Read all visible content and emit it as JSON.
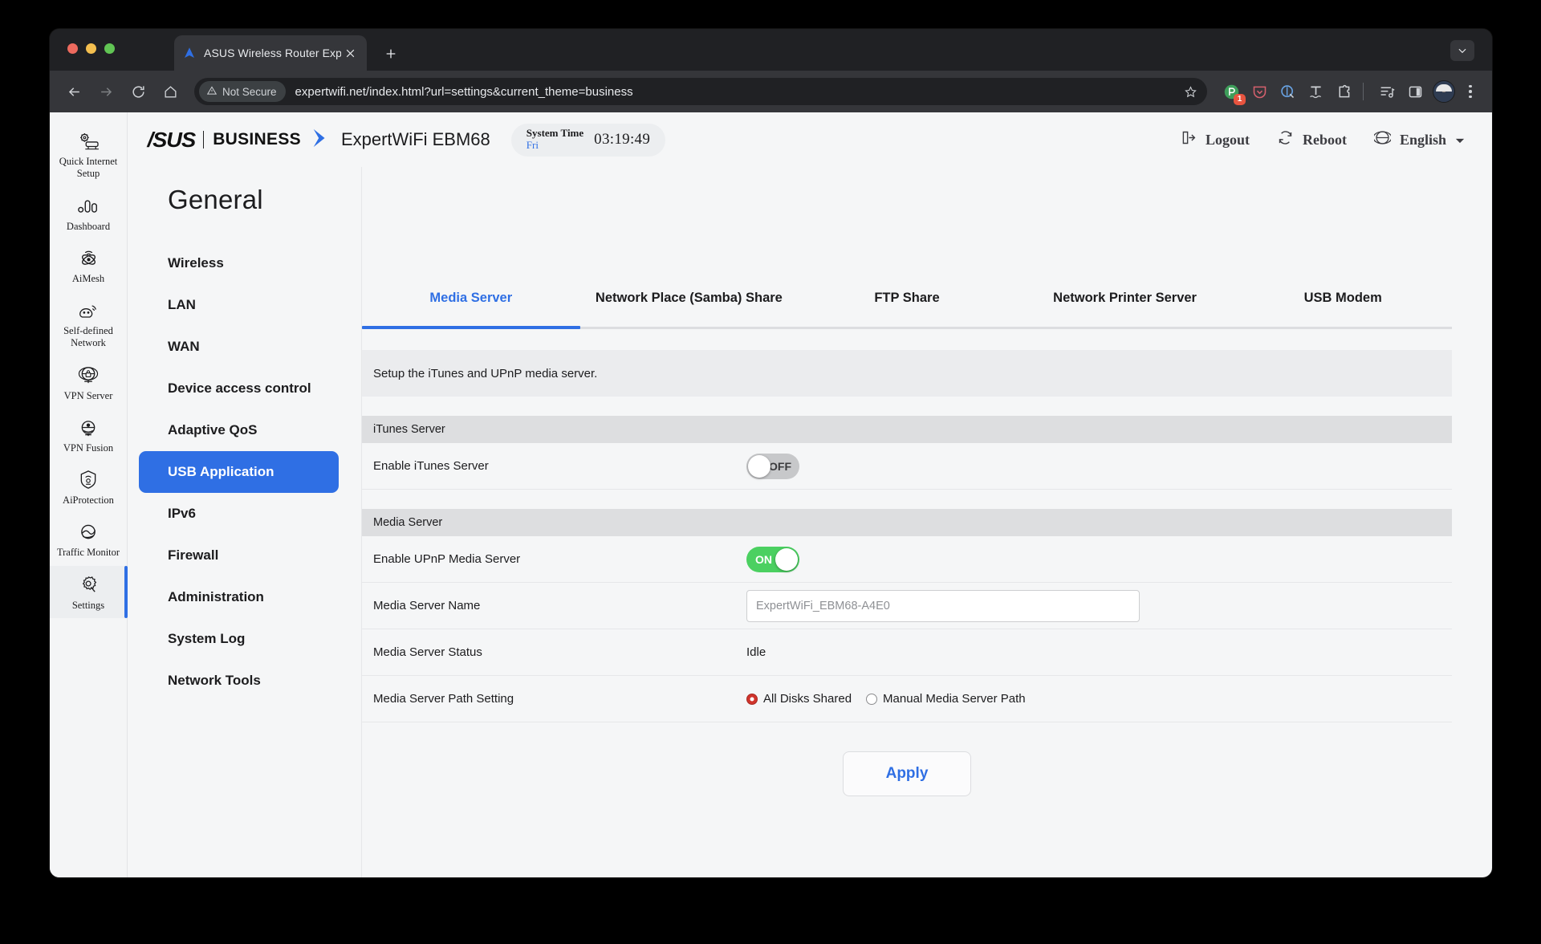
{
  "browser": {
    "tab": {
      "title": "ASUS Wireless Router Expert",
      "favicon_icon": "asus-router-favicon",
      "close_icon": "close-icon"
    },
    "new_tab_icon": "plus-icon",
    "tab_list_icon": "chevron-down-icon",
    "back_icon": "arrow-left-icon",
    "forward_icon": "arrow-right-icon",
    "reload_icon": "reload-icon",
    "home_icon": "home-icon",
    "security_label": "Not Secure",
    "security_icon": "warning-triangle-icon",
    "url": "expertwifi.net/index.html?url=settings&current_theme=business",
    "bookmark_icon": "star-icon",
    "extensions": [
      {
        "name": "ext-proton-pass-icon",
        "badge": "1"
      },
      {
        "name": "ext-pocket-icon",
        "badge": ""
      },
      {
        "name": "ext-privacy-badger-icon",
        "badge": ""
      },
      {
        "name": "ext-languagetool-icon",
        "badge": ""
      },
      {
        "name": "ext-puzzle-icon",
        "badge": ""
      }
    ],
    "reading_list_icon": "reading-list-icon",
    "side_panel_icon": "side-panel-icon",
    "profile_icon": "avatar",
    "menu_icon": "kebab-menu-icon"
  },
  "rail": {
    "items": [
      {
        "label": "Quick Internet Setup",
        "icon": "quick-internet-setup-icon",
        "active": false
      },
      {
        "label": "Dashboard",
        "icon": "dashboard-icon",
        "active": false
      },
      {
        "label": "AiMesh",
        "icon": "aimesh-icon",
        "active": false
      },
      {
        "label": "Self-defined Network",
        "icon": "self-defined-network-icon",
        "active": false
      },
      {
        "label": "VPN Server",
        "icon": "vpn-server-icon",
        "active": false
      },
      {
        "label": "VPN Fusion",
        "icon": "vpn-fusion-icon",
        "active": false
      },
      {
        "label": "AiProtection",
        "icon": "aiprotection-icon",
        "active": false
      },
      {
        "label": "Traffic Monitor",
        "icon": "traffic-monitor-icon",
        "active": false
      },
      {
        "label": "Settings",
        "icon": "settings-gear-icon",
        "active": true
      }
    ]
  },
  "general": {
    "title": "General",
    "items": [
      {
        "label": "Wireless",
        "active": false
      },
      {
        "label": "LAN",
        "active": false
      },
      {
        "label": "WAN",
        "active": false
      },
      {
        "label": "Device access control",
        "active": false
      },
      {
        "label": "Adaptive QoS",
        "active": false
      },
      {
        "label": "USB Application",
        "active": true
      },
      {
        "label": "IPv6",
        "active": false
      },
      {
        "label": "Firewall",
        "active": false
      },
      {
        "label": "Administration",
        "active": false
      },
      {
        "label": "System Log",
        "active": false
      },
      {
        "label": "Network Tools",
        "active": false
      }
    ]
  },
  "header": {
    "logo": "/SUS",
    "business": "BUSINESS",
    "chevron_icon": "brand-chevron-icon",
    "model": "ExpertWiFi EBM68",
    "system_time_label": "System Time",
    "system_time_day": "Fri",
    "system_time_clock": "03:19:49",
    "logout_label": "Logout",
    "logout_icon": "logout-icon",
    "reboot_label": "Reboot",
    "reboot_icon": "reboot-icon",
    "language_label": "English",
    "language_icon": "globe-icon",
    "language_caret_icon": "caret-down-icon"
  },
  "tabs": [
    {
      "label": "Media Server",
      "active": true
    },
    {
      "label": "Network Place (Samba) Share",
      "active": false
    },
    {
      "label": "FTP Share",
      "active": false
    },
    {
      "label": "Network Printer Server",
      "active": false
    },
    {
      "label": "USB Modem",
      "active": false
    }
  ],
  "content": {
    "notice": "Setup the iTunes and UPnP media server.",
    "itunes_section": "iTunes Server",
    "itunes_row_label": "Enable iTunes Server",
    "itunes_toggle_state": "OFF",
    "media_section": "Media Server",
    "upnp_row_label": "Enable UPnP Media Server",
    "upnp_toggle_state": "ON",
    "server_name_label": "Media Server Name",
    "server_name_value": "ExpertWiFi_EBM68-A4E0",
    "status_label": "Media Server Status",
    "status_value": "Idle",
    "path_label": "Media Server Path Setting",
    "path_options": [
      {
        "label": "All Disks Shared",
        "selected": true
      },
      {
        "label": "Manual Media Server Path",
        "selected": false
      }
    ],
    "apply_label": "Apply"
  },
  "colors": {
    "accent_blue": "#2f6fe4",
    "toggle_on_green": "#4bd061",
    "radio_red": "#d0342c"
  }
}
